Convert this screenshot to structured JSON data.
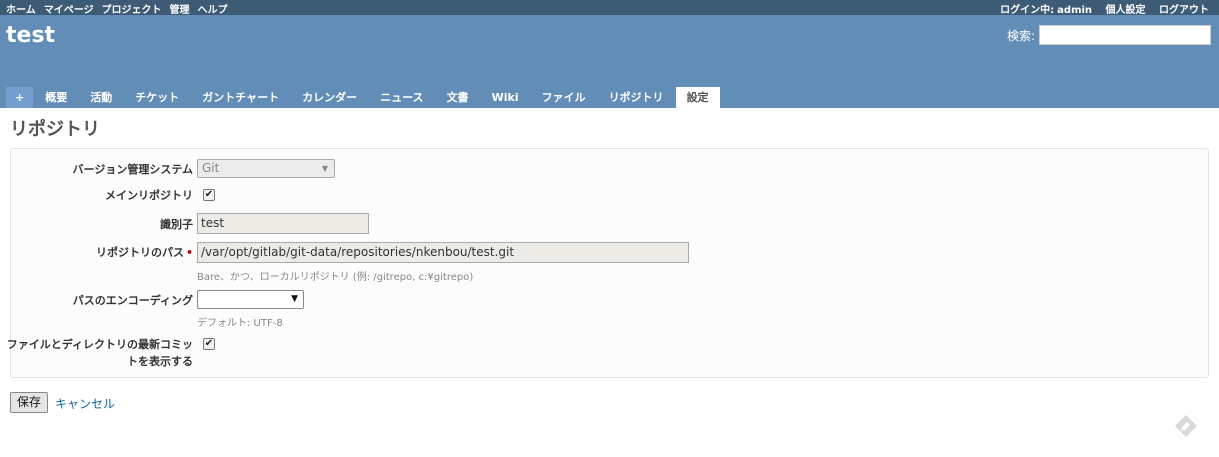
{
  "top_menu": {
    "items": [
      "ホーム",
      "マイページ",
      "プロジェクト",
      "管理",
      "ヘルプ"
    ],
    "logged_in_label": "ログイン中:",
    "user": "admin",
    "my_account": "個人設定",
    "logout": "ログアウト"
  },
  "header": {
    "project_title": "test",
    "search_label": "検索:",
    "search_value": ""
  },
  "tabs": {
    "new": "+",
    "items": [
      "概要",
      "活動",
      "チケット",
      "ガントチャート",
      "カレンダー",
      "ニュース",
      "文書",
      "Wiki",
      "ファイル",
      "リポジトリ",
      "設定"
    ],
    "selected": "設定"
  },
  "page_title": "リポジトリ",
  "form": {
    "scm_label": "バージョン管理システム",
    "scm_value": "Git",
    "main_repo_label": "メインリポジトリ",
    "main_repo_checked": true,
    "identifier_label": "識別子",
    "identifier_value": "test",
    "path_label": "リポジトリのパス",
    "required_mark": "•",
    "path_value": "/var/opt/gitlab/git-data/repositories/nkenbou/test.git",
    "path_hint": "Bare、かつ、ローカルリポジトリ (例: /gitrepo, c:¥gitrepo)",
    "encoding_label": "パスのエンコーディング",
    "encoding_value": "",
    "encoding_hint": "デフォルト: UTF-8",
    "report_last_commit_label_1": "ファイルとディレクトリの最新コミッ",
    "report_last_commit_label_2": "トを表示する",
    "report_last_commit_checked": true
  },
  "buttons": {
    "save": "保存",
    "cancel": "キャンセル"
  },
  "colors": {
    "top_menu_bg": "#3e5b76",
    "header_bg": "#628db6",
    "link": "#116699"
  }
}
